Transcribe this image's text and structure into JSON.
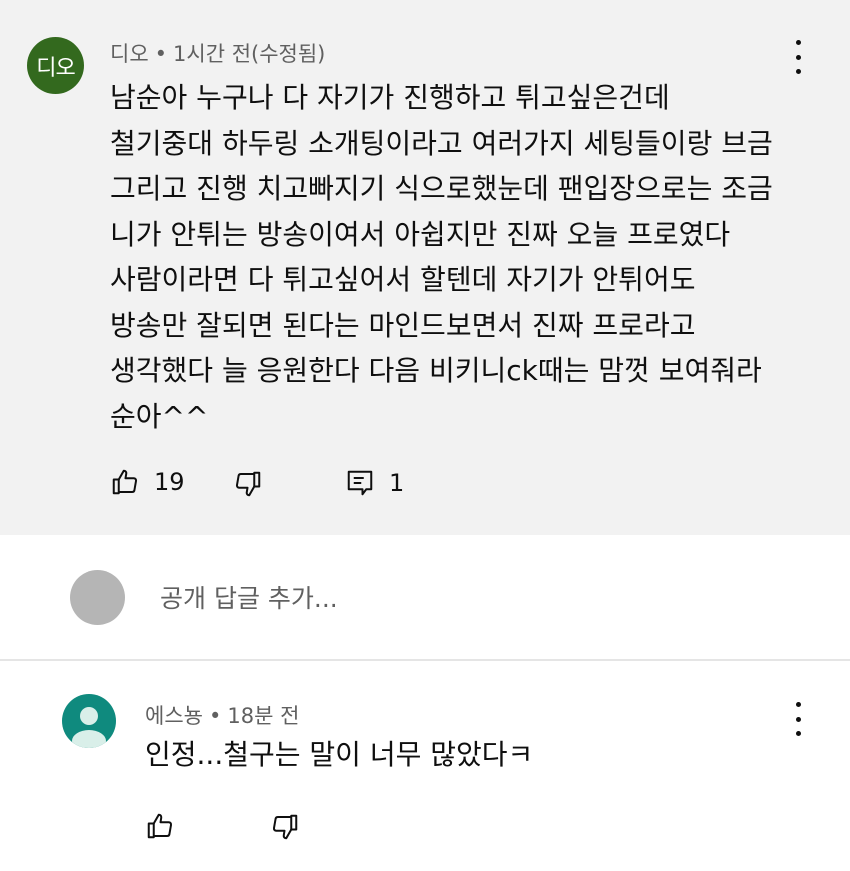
{
  "comment": {
    "avatar_text": "디오",
    "author": "디오",
    "separator": "•",
    "time": "1시간 전(수정됨)",
    "lines": [
      "남순아 누구나 다 자기가 진행하고 튀고싶은건데",
      "철기중대 하두링 소개팅이라고 여러가지 세팅들이랑 브금",
      "그리고 진행 치고빠지기 식으로했눈데 팬입장으로는 조금",
      "니가 안튀는 방송이여서 아쉽지만 진짜 오늘 프로였다",
      "사람이라면 다 튀고싶어서 할텐데 자기가 안튀어도",
      "방송만 잘되면 된다는 마인드보면서 진짜 프로라고",
      "생각했다 늘 응원한다 다음 비키니ck때는 맘껏 보여줘라",
      "순아^^"
    ],
    "like_count": "19",
    "reply_count": "1"
  },
  "reply_box": {
    "placeholder": "공개 답글 추가..."
  },
  "reply": {
    "author": "에스뇽",
    "separator": "•",
    "time": "18분 전",
    "text": "인정...철구는 말이 너무 많았다ㅋ"
  },
  "colors": {
    "comment_bg": "#f2f2f2",
    "avatar_do": "#33691e",
    "avatar_user": "#0f8a7e",
    "meta_text": "#606060"
  },
  "icons": [
    "like-icon",
    "dislike-icon",
    "reply-icon",
    "more-vert-icon",
    "default-avatar-icon"
  ]
}
